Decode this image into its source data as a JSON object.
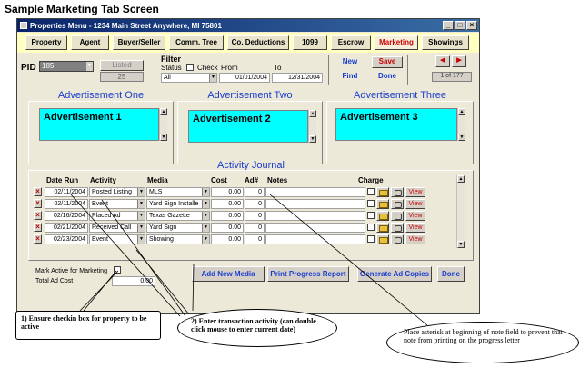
{
  "page_title": "Sample Marketing Tab Screen",
  "window": {
    "title": "Properties Menu - 1234 Main Street Anywhere, MI 75801",
    "controls": [
      "_",
      "□",
      "×"
    ]
  },
  "tabs": [
    {
      "label": "Property",
      "active": false
    },
    {
      "label": "Agent",
      "active": false
    },
    {
      "label": "Buyer/Seller",
      "active": false
    },
    {
      "label": "Comm. Tree",
      "active": false
    },
    {
      "label": "Co. Deductions",
      "active": false
    },
    {
      "label": "1099",
      "active": false
    },
    {
      "label": "Escrow",
      "active": false
    },
    {
      "label": "Marketing",
      "active": true
    },
    {
      "label": "Showings",
      "active": false
    }
  ],
  "header": {
    "pid_label": "PID",
    "pid_value": "185",
    "listed_button": "Listed",
    "listed_value": "25",
    "filter_label": "Filter",
    "status_label": "Status",
    "check_label": "Check",
    "from_label": "From",
    "to_label": "To",
    "status_value": "All",
    "from_date": "01/01/2004",
    "to_date": "12/31/2004",
    "new_button": "New",
    "save_button": "Save",
    "find_button": "Find",
    "done_button": "Done",
    "record_count": "1 of 177",
    "prev_icon": "◀",
    "next_icon": "▶"
  },
  "advertisements": [
    {
      "heading": "Advertisement One",
      "text": "Advertisement 1"
    },
    {
      "heading": "Advertisement Two",
      "text": "Advertisement 2"
    },
    {
      "heading": "Advertisement Three",
      "text": "Advertisement 3"
    }
  ],
  "journal": {
    "title": "Activity Journal",
    "columns": {
      "date_run": "Date Run",
      "activity": "Activity",
      "media": "Media",
      "cost": "Cost",
      "ad_num": "Ad#",
      "notes": "Notes",
      "charge": "Charge"
    },
    "view_label": "View",
    "rows": [
      {
        "date": "02/11/2004",
        "activity": "Posted Listing",
        "media": "MLS",
        "cost": "0.00",
        "ad": "0",
        "notes": ""
      },
      {
        "date": "02/11/2004",
        "activity": "Event",
        "media": "Yard Sign Installe",
        "cost": "0.00",
        "ad": "0",
        "notes": ""
      },
      {
        "date": "02/16/2004",
        "activity": "Placed Ad",
        "media": "Texas Gazette",
        "cost": "0.00",
        "ad": "0",
        "notes": ""
      },
      {
        "date": "02/21/2004",
        "activity": "Received Call",
        "media": "Yard Sign",
        "cost": "0.00",
        "ad": "0",
        "notes": ""
      },
      {
        "date": "02/23/2004",
        "activity": "Event",
        "media": "Showing",
        "cost": "0.00",
        "ad": "0",
        "notes": ""
      }
    ]
  },
  "footer": {
    "mark_active_label": "Mark Active for Marketing",
    "total_ad_cost_label": "Total Ad Cost",
    "total_ad_cost_value": "0.00",
    "add_media_button": "Add New Media",
    "print_report_button": "Print Progress Report",
    "generate_copies_button": "Generate Ad Copies",
    "done_button": "Done"
  },
  "callouts": {
    "c1": "1) Ensure checkin box for property to be active",
    "c2": "2) Enter transaction activity (can double click mouse to enter current date)",
    "c3": "Place asterisk at beginning of note field to prevent that note from printing on the progress letter"
  },
  "colors": {
    "ad_box": "#00ffff",
    "section_title": "#1a3ccf",
    "tab_bar": "#ffffc0",
    "active_tab": "#cc0000"
  }
}
